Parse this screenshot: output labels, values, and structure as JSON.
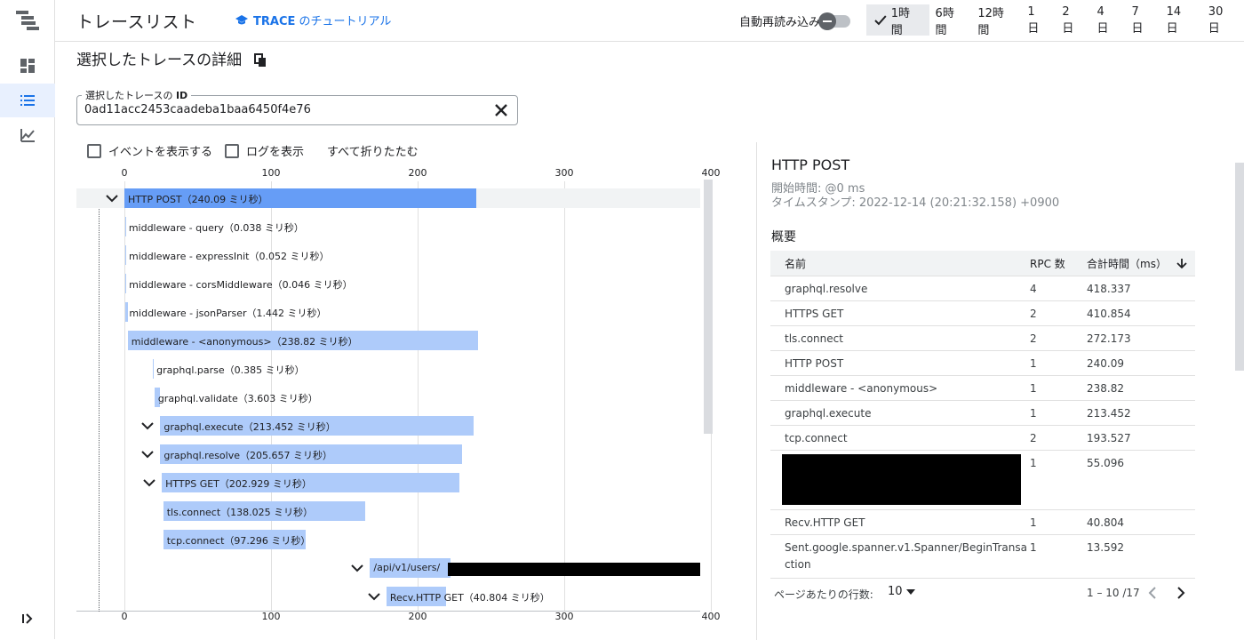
{
  "header": {
    "title": "トレースリスト",
    "tutorial_prefix": "TRACE",
    "tutorial_suffix": " のチュートリアル",
    "autoreload_label": "自動再読み込み",
    "ranges": [
      "1時間",
      "6時間",
      "12時間",
      "1 日",
      "2 日",
      "4 日",
      "7 日",
      "14 日",
      "30 日"
    ],
    "selected_range": "1時間"
  },
  "details": {
    "title": "選択したトレースの詳細",
    "id_label": "選択したトレースの ID",
    "id_label_bold": "ID",
    "id_value": "0ad11acc2453caadeba1baa6450f4e76",
    "show_events": "イベントを表示する",
    "show_logs": "ログを表示",
    "collapse_all": "すべて折りたたむ"
  },
  "timeline": {
    "axis_ticks": [
      "0",
      "100",
      "200",
      "300",
      "400"
    ],
    "axis_max": 400,
    "spans": [
      {
        "label": "HTTP POST（240.09 ミリ秒）",
        "start": 0,
        "duration": 240.09,
        "depth": 0,
        "expand": true
      },
      {
        "label": "middleware - query（0.038 ミリ秒）",
        "start": 0.5,
        "duration": 0.038,
        "depth": 0,
        "expand": false
      },
      {
        "label": "middleware - expressInit（0.052 ミリ秒）",
        "start": 0.6,
        "duration": 0.052,
        "depth": 0,
        "expand": false
      },
      {
        "label": "middleware - corsMiddleware（0.046 ミリ秒）",
        "start": 0.7,
        "duration": 0.046,
        "depth": 0,
        "expand": false
      },
      {
        "label": "middleware - jsonParser（1.442 ミリ秒）",
        "start": 0.8,
        "duration": 1.442,
        "depth": 0,
        "expand": false
      },
      {
        "label": "middleware - <anonymous>（238.82 ミリ秒）",
        "start": 2.3,
        "duration": 238.82,
        "depth": 0,
        "expand": false
      },
      {
        "label": "graphql.parse（0.385 ミリ秒）",
        "start": 19.5,
        "duration": 0.385,
        "depth": 1,
        "expand": false
      },
      {
        "label": "graphql.validate（3.603 ミリ秒）",
        "start": 20.5,
        "duration": 3.603,
        "depth": 1,
        "expand": false
      },
      {
        "label": "graphql.execute（213.452 ミリ秒）",
        "start": 24.5,
        "duration": 213.452,
        "depth": 1,
        "expand": true
      },
      {
        "label": "graphql.resolve（205.657 ミリ秒）",
        "start": 24.5,
        "duration": 205.657,
        "depth": 1,
        "expand": true
      },
      {
        "label": "HTTPS GET（202.929 ミリ秒）",
        "start": 25.5,
        "duration": 202.929,
        "depth": 1,
        "expand": true
      },
      {
        "label": "tls.connect（138.025 ミリ秒）",
        "start": 26.5,
        "duration": 138.025,
        "depth": 2,
        "expand": false
      },
      {
        "label": "tcp.connect（97.296 ミリ秒）",
        "start": 26.5,
        "duration": 97.296,
        "depth": 2,
        "expand": false
      },
      {
        "label": "/api/v1/users/",
        "start": 167.5,
        "duration": 55.096,
        "depth": 3,
        "expand": true,
        "redacted": true
      },
      {
        "label": "Recv.HTTP GET（40.804 ミリ秒）",
        "start": 178.7,
        "duration": 40.804,
        "depth": 4,
        "expand": true
      }
    ]
  },
  "panel": {
    "title": "HTTP POST",
    "start_time": "開始時間: @0 ms",
    "timestamp": "タイムスタンプ: 2022-12-14 (20:21:32.158) +0900",
    "overview": "概要",
    "columns": [
      "名前",
      "RPC 数",
      "合計時間（ms）"
    ],
    "rows": [
      {
        "name": "graphql.resolve",
        "rpc": "4",
        "total": "418.337"
      },
      {
        "name": "HTTPS GET",
        "rpc": "2",
        "total": "410.854"
      },
      {
        "name": "tls.connect",
        "rpc": "2",
        "total": "272.173"
      },
      {
        "name": "HTTP POST",
        "rpc": "1",
        "total": "240.09"
      },
      {
        "name": "middleware - <anonymous>",
        "rpc": "1",
        "total": "238.82"
      },
      {
        "name": "graphql.execute",
        "rpc": "1",
        "total": "213.452"
      },
      {
        "name": "tcp.connect",
        "rpc": "2",
        "total": "193.527"
      },
      {
        "name": "",
        "rpc": "1",
        "total": "55.096",
        "redacted": true
      },
      {
        "name": "Recv.HTTP GET",
        "rpc": "1",
        "total": "40.804"
      },
      {
        "name": "Sent.google.spanner.v1.Spanner/BeginTransaction",
        "rpc": "1",
        "total": "13.592"
      }
    ],
    "rows_per_page_label": "ページあたりの行数:",
    "rows_per_page": "10",
    "range_text": "1 – 10 /17"
  },
  "colors": {
    "accent": "#1a73e8",
    "bar_light": "#aecbfa",
    "bar_dark": "#669df6"
  }
}
